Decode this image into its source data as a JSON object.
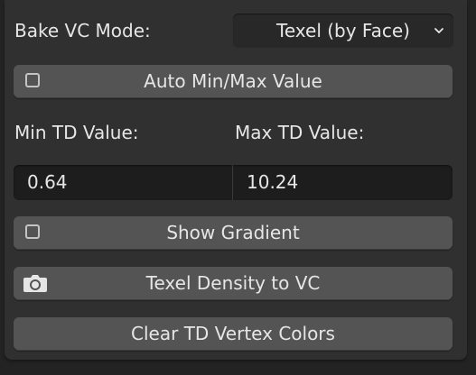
{
  "bake_vc_mode": {
    "label": "Bake VC Mode:",
    "selected": "Texel (by Face)"
  },
  "auto_minmax": {
    "label": "Auto Min/Max Value",
    "checked": false
  },
  "min_td": {
    "label": "Min TD Value:",
    "value": "0.64"
  },
  "max_td": {
    "label": "Max TD Value:",
    "value": "10.24"
  },
  "show_gradient": {
    "label": "Show Gradient",
    "checked": false
  },
  "texel_to_vc": {
    "label": "Texel Density to VC",
    "icon": "camera-icon"
  },
  "clear_td": {
    "label": "Clear TD Vertex Colors"
  },
  "colors": {
    "panel": "#303030",
    "button": "#545454",
    "field": "#1d1d1d",
    "text": "#e6e6e6"
  }
}
